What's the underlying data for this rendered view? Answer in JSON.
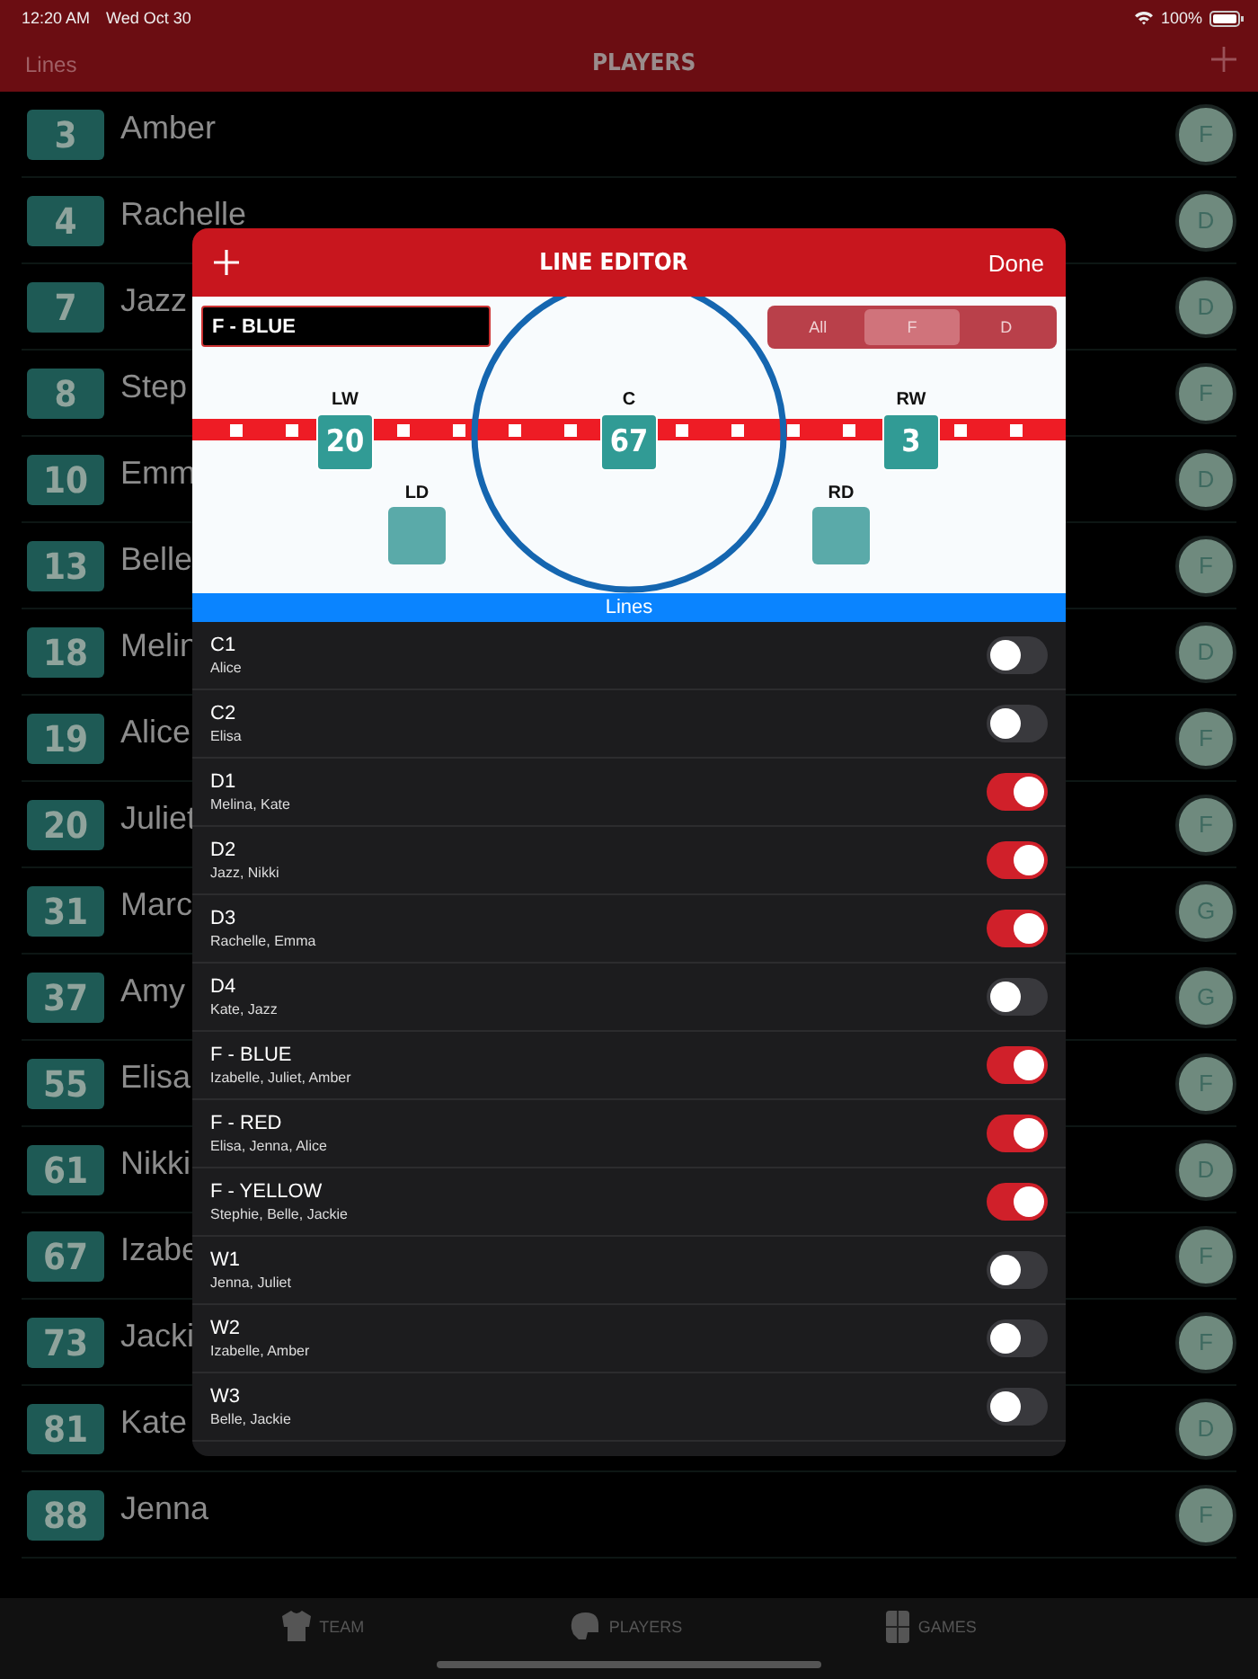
{
  "status_bar": {
    "time": "12:20 AM",
    "date": "Wed Oct 30",
    "battery": "100%"
  },
  "nav": {
    "back": "Lines",
    "title": "PLAYERS"
  },
  "players": [
    {
      "number": "3",
      "name": "Amber",
      "position": "F"
    },
    {
      "number": "4",
      "name": "Rachelle",
      "position": "D"
    },
    {
      "number": "7",
      "name": "Jazz",
      "position": "D"
    },
    {
      "number": "8",
      "name": "Step",
      "position": "F"
    },
    {
      "number": "10",
      "name": "Emm",
      "position": "D"
    },
    {
      "number": "13",
      "name": "Belle",
      "position": "F"
    },
    {
      "number": "18",
      "name": "Melin",
      "position": "D"
    },
    {
      "number": "19",
      "name": "Alice",
      "position": "F"
    },
    {
      "number": "20",
      "name": "Juliet",
      "position": "F"
    },
    {
      "number": "31",
      "name": "Marc",
      "position": "G"
    },
    {
      "number": "37",
      "name": "Amy",
      "position": "G"
    },
    {
      "number": "55",
      "name": "Elisa",
      "position": "F"
    },
    {
      "number": "61",
      "name": "Nikki",
      "position": "D"
    },
    {
      "number": "67",
      "name": "Izabe",
      "position": "F"
    },
    {
      "number": "73",
      "name": "Jacki",
      "position": "F"
    },
    {
      "number": "81",
      "name": "Kate",
      "position": "D"
    },
    {
      "number": "88",
      "name": "Jenna",
      "position": "F"
    }
  ],
  "modal": {
    "title": "LINE EDITOR",
    "done": "Done",
    "line_name": "F - BLUE",
    "filter": [
      {
        "label": "All",
        "selected": false
      },
      {
        "label": "F",
        "selected": true
      },
      {
        "label": "D",
        "selected": false
      }
    ],
    "positions": [
      {
        "kind": "lw",
        "label": "LW",
        "number": "20"
      },
      {
        "kind": "c",
        "label": "C",
        "number": "67"
      },
      {
        "kind": "rw",
        "label": "RW",
        "number": "3"
      },
      {
        "kind": "ld",
        "label": "LD"
      },
      {
        "kind": "rd",
        "label": "RD"
      }
    ],
    "lines_header": "Lines",
    "lines": [
      {
        "name": "C1",
        "players": "Alice",
        "on": false
      },
      {
        "name": "C2",
        "players": "Elisa",
        "on": false
      },
      {
        "name": "D1",
        "players": "Melina, Kate",
        "on": true
      },
      {
        "name": "D2",
        "players": "Jazz, Nikki",
        "on": true
      },
      {
        "name": "D3",
        "players": "Rachelle, Emma",
        "on": true
      },
      {
        "name": "D4",
        "players": "Kate, Jazz",
        "on": false
      },
      {
        "name": "F - BLUE",
        "players": "Izabelle, Juliet, Amber",
        "on": true
      },
      {
        "name": "F - RED",
        "players": "Elisa, Jenna, Alice",
        "on": true
      },
      {
        "name": "F - YELLOW",
        "players": "Stephie, Belle, Jackie",
        "on": true
      },
      {
        "name": "W1",
        "players": "Jenna, Juliet",
        "on": false
      },
      {
        "name": "W2",
        "players": "Izabelle, Amber",
        "on": false
      },
      {
        "name": "W3",
        "players": "Belle, Jackie",
        "on": false
      }
    ]
  },
  "tab_bar": [
    {
      "kind": "jersey",
      "label": "TEAM"
    },
    {
      "kind": "helmet",
      "label": "PLAYERS"
    },
    {
      "kind": "rink",
      "label": "GAMES"
    }
  ]
}
